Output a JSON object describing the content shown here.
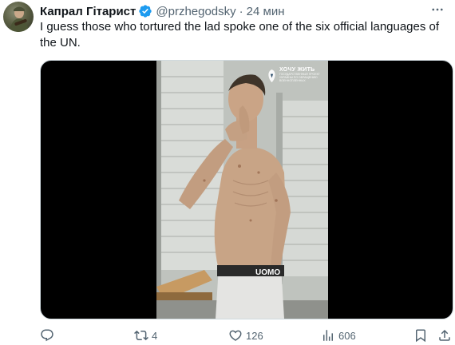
{
  "tweet": {
    "author_name": "Капрал Гітарист",
    "handle": "@przhegodsky",
    "separator": "·",
    "time": "24 мин",
    "text": "I guess those who tortured the lad spoke one of the six official languages of the UN.",
    "media": {
      "watermark_title": "ХОЧУ ЖИТЬ",
      "watermark_subtitle": "ГОСУДАРСТВЕННЫЙ ПРОЕКТ УКРАИНЫ ПО ОБРАЩЕНИЮ ВОЕННОПЛЕННЫХ",
      "waistband_text": "UOMO"
    },
    "actions": {
      "reply_count": "",
      "retweet_count": "4",
      "like_count": "126",
      "view_count": "606"
    }
  },
  "colors": {
    "text": "#0f1419",
    "secondary": "#536471",
    "verified": "#1d9bf0",
    "media_bg": "#000000"
  },
  "icons": [
    "verified-badge-icon",
    "more-icon",
    "reply-icon",
    "retweet-icon",
    "like-icon",
    "views-icon",
    "bookmark-icon",
    "share-icon"
  ]
}
